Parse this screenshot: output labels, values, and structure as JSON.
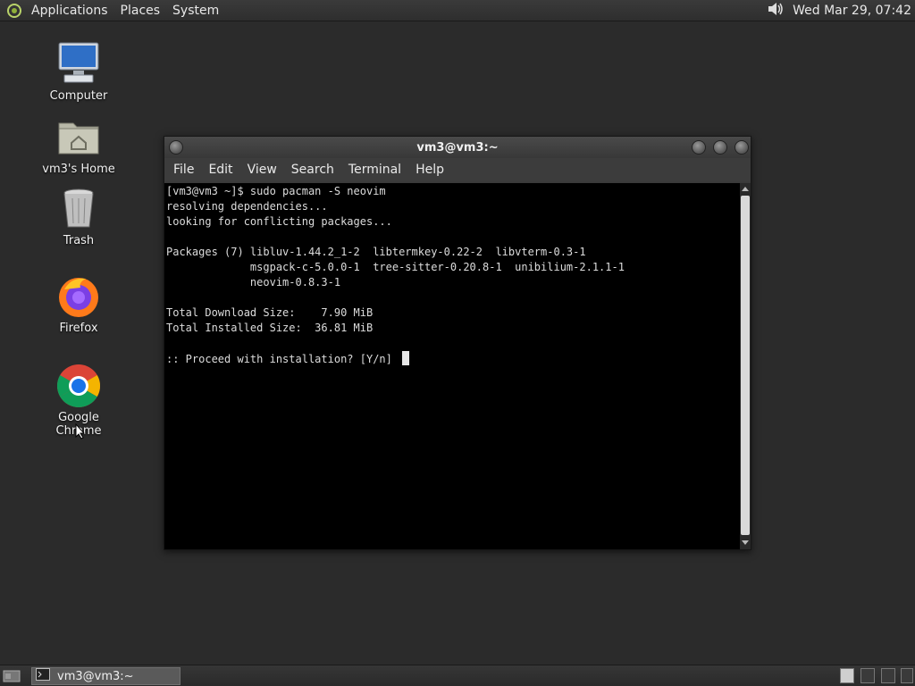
{
  "top_panel": {
    "menus": [
      "Applications",
      "Places",
      "System"
    ],
    "clock": "Wed Mar 29, 07:42"
  },
  "desktop": {
    "icons": [
      {
        "label": "Computer",
        "icon": "computer-icon"
      },
      {
        "label": "vm3's Home",
        "icon": "home-folder-icon"
      },
      {
        "label": "Trash",
        "icon": "trash-icon"
      },
      {
        "label": "Firefox",
        "icon": "firefox-icon"
      },
      {
        "label": "Google Chrome",
        "icon": "chrome-icon"
      }
    ]
  },
  "terminal": {
    "title": "vm3@vm3:~",
    "menu": [
      "File",
      "Edit",
      "View",
      "Search",
      "Terminal",
      "Help"
    ],
    "lines": [
      "[vm3@vm3 ~]$ sudo pacman -S neovim",
      "resolving dependencies...",
      "looking for conflicting packages...",
      "",
      "Packages (7) libluv-1.44.2_1-2  libtermkey-0.22-2  libvterm-0.3-1",
      "             msgpack-c-5.0.0-1  tree-sitter-0.20.8-1  unibilium-2.1.1-1",
      "             neovim-0.8.3-1",
      "",
      "Total Download Size:    7.90 MiB",
      "Total Installed Size:  36.81 MiB",
      "",
      ":: Proceed with installation? [Y/n] "
    ]
  },
  "bottom_panel": {
    "task_label": "vm3@vm3:~"
  }
}
